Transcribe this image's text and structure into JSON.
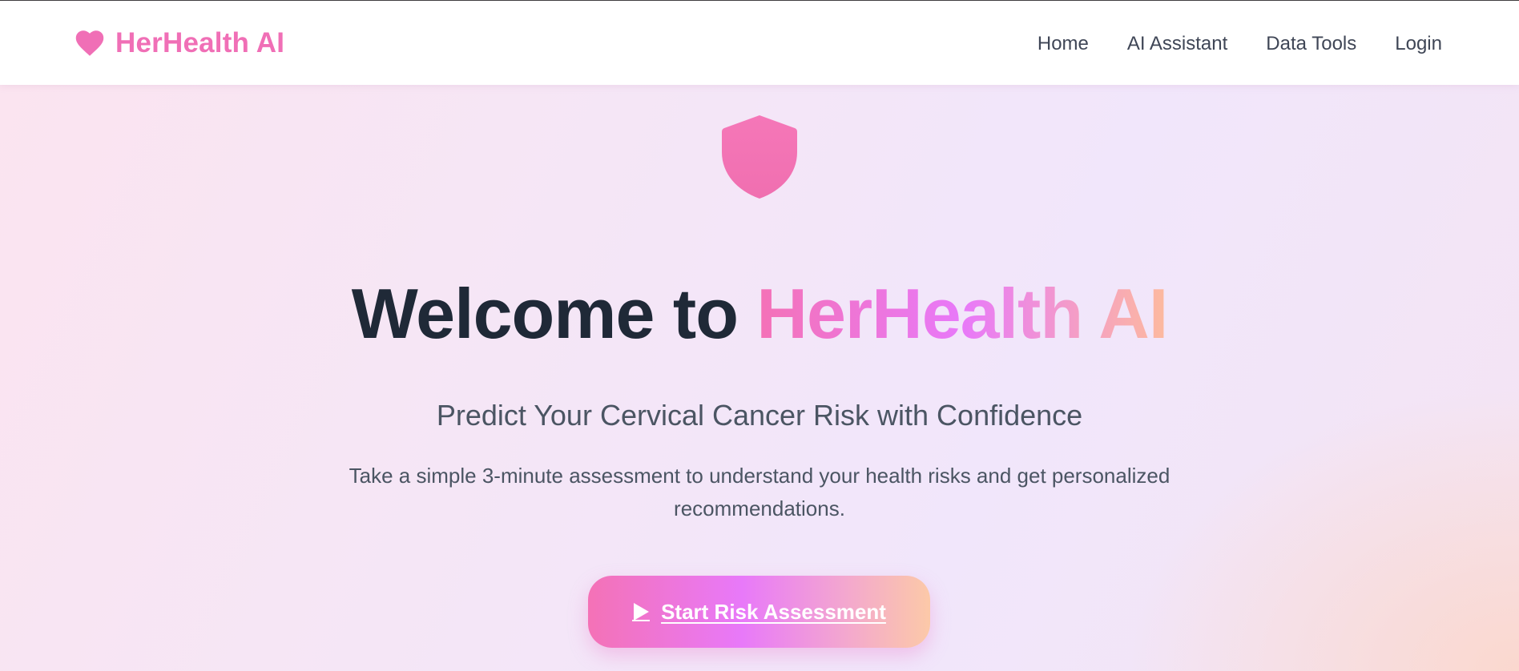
{
  "brand": {
    "name": "HerHealth AI",
    "icon": "heart-icon",
    "color": "#f06fb6"
  },
  "nav": {
    "items": [
      {
        "label": "Home"
      },
      {
        "label": "AI Assistant"
      },
      {
        "label": "Data Tools"
      },
      {
        "label": "Login"
      }
    ]
  },
  "hero": {
    "icon": "shield-icon",
    "headline_prefix": "Welcome to ",
    "headline_highlight": "HerHealth AI",
    "subtitle": "Predict Your Cervical Cancer Risk with Confidence",
    "description": "Take a simple 3-minute assessment to understand your health risks and get personalized recommendations.",
    "cta": {
      "label": "Start Risk Assessment",
      "icon": "play-icon"
    }
  },
  "colors": {
    "accent_pink": "#f472b6",
    "accent_purple": "#e879f9",
    "accent_peach": "#fdba9e",
    "text_dark": "#1f2937",
    "text_muted": "#4b5563"
  }
}
